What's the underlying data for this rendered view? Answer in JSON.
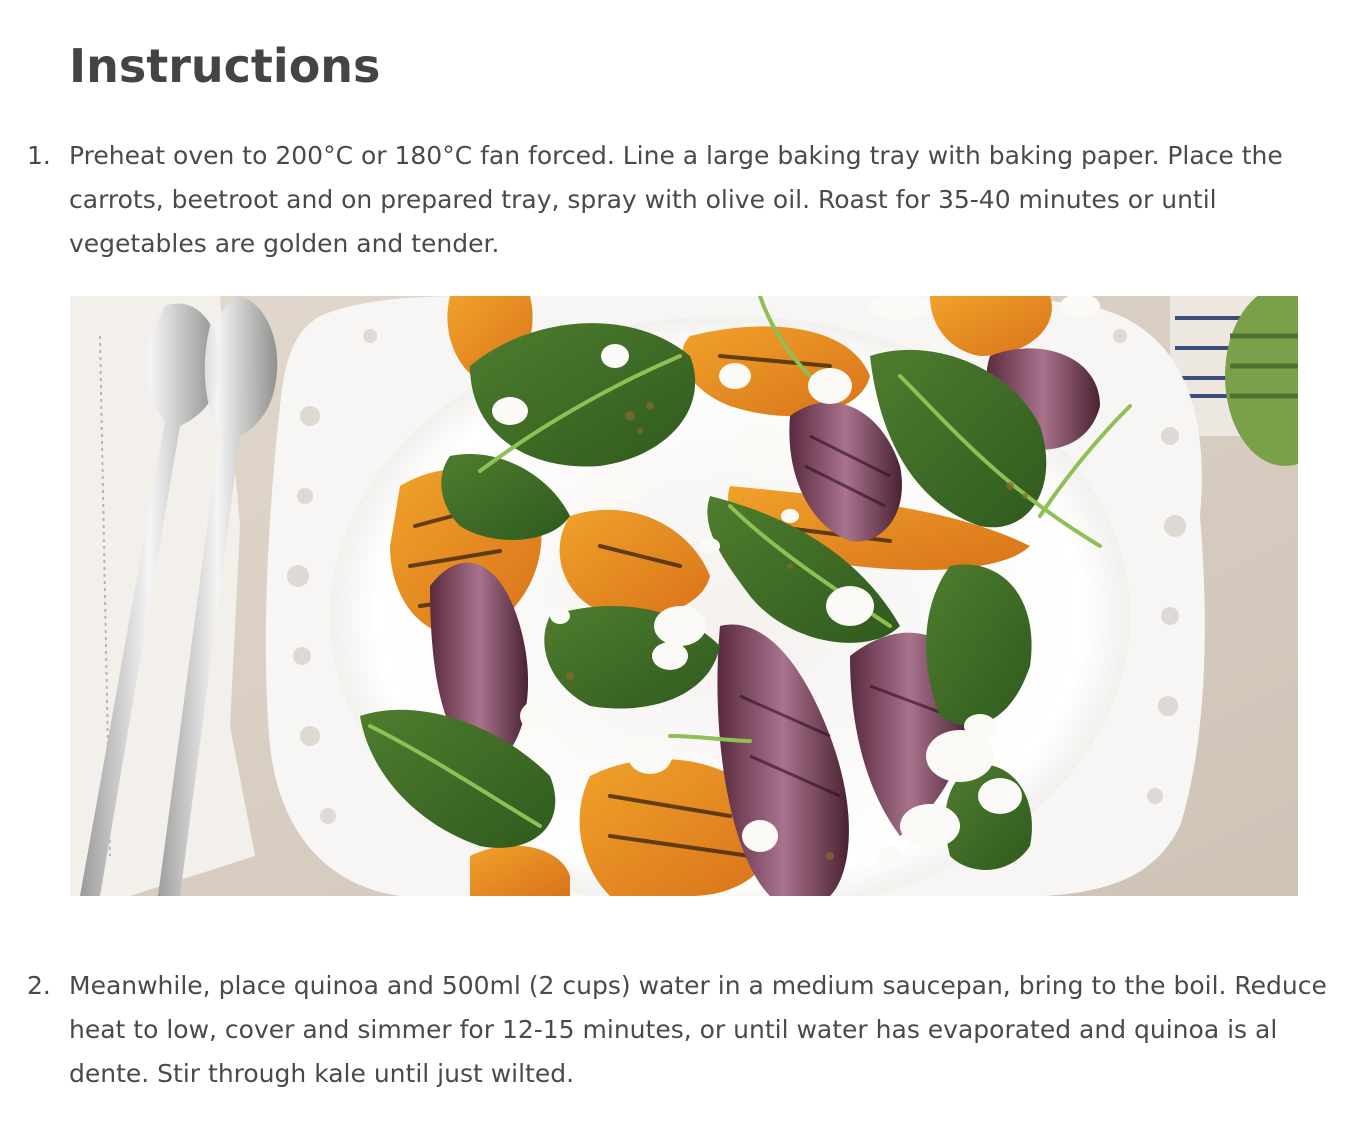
{
  "heading": "Instructions",
  "steps": [
    {
      "number": "1.",
      "text": "Preheat oven to 200°C or 180°C fan forced. Line a large baking tray with baking paper. Place the carrots, beetroot and on prepared tray, spray with olive oil. Roast for 35-40 minutes or until vegetables are golden and tender."
    },
    {
      "number": "2.",
      "text": "Meanwhile, place quinoa and 500ml (2 cups) water in a medium saucepan, bring to the boil. Reduce heat to low, cover and simmer for 12-15 minutes, or until water has evaporated and quinoa is al dente. Stir through kale until just wilted."
    }
  ],
  "photo": {
    "subject": "roasted pumpkin, red onion, spinach and feta salad in a white lace-edged bowl with silver servers"
  },
  "colors": {
    "text": "#4a4a4a",
    "heading": "#444444",
    "background": "#ffffff"
  }
}
